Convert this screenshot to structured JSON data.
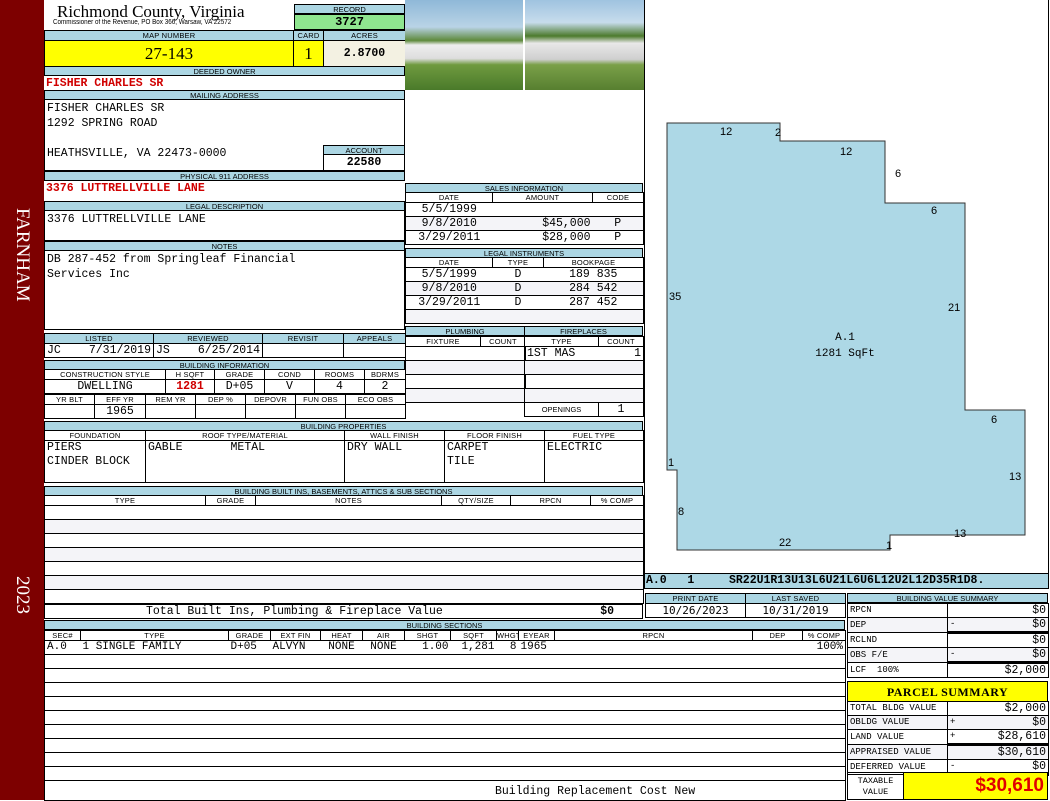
{
  "sidebar": {
    "district": "FARNHAM",
    "year": "2023"
  },
  "header": {
    "county": "Richmond County, Virginia",
    "office": "Commissioner of the Revenue, PO Box 366, Warsaw, VA 22572",
    "record_label": "RECORD",
    "record": "3727"
  },
  "parcel": {
    "map_label": "MAP NUMBER",
    "map_number": "27-143",
    "card_label": "CARD",
    "card": "1",
    "acres_label": "ACRES",
    "acres": "2.8700"
  },
  "owner": {
    "label": "DEEDED OWNER",
    "name": "FISHER CHARLES SR"
  },
  "mailing": {
    "label": "MAILING ADDRESS",
    "line1": "FISHER CHARLES SR",
    "line2": "1292 SPRING ROAD",
    "line3": "HEATHSVILLE, VA 22473-0000",
    "account_label": "ACCOUNT",
    "account": "22580"
  },
  "physical": {
    "label": "PHYSICAL 911 ADDRESS",
    "address": "3376 LUTTRELLVILLE LANE"
  },
  "legal": {
    "label": "LEGAL DESCRIPTION",
    "text": "3376 LUTTRELLVILLE LANE"
  },
  "notes": {
    "label": "NOTES",
    "line1": "DB 287-452 from Springleaf Financial",
    "line2": "Services Inc"
  },
  "review": {
    "listed_label": "LISTED",
    "reviewed_label": "REVIEWED",
    "revisit_label": "REVISIT",
    "appeals_label": "APPEALS",
    "listed_by": "JC",
    "listed_date": "7/31/2019",
    "reviewed_by": "JS",
    "reviewed_date": "6/25/2014"
  },
  "building_info": {
    "label": "BUILDING INFORMATION",
    "h1": [
      "CONSTRUCTION STYLE",
      "H SQFT",
      "GRADE",
      "COND",
      "ROOMS",
      "BDRMS"
    ],
    "v1": [
      "DWELLING",
      "1281",
      "D+05",
      "V",
      "4",
      "2"
    ],
    "h2": [
      "YR BLT",
      "EFF YR",
      "REM YR",
      "DEP %",
      "DEPOVR",
      "FUN OBS",
      "ECO OBS"
    ],
    "v2": [
      "",
      "1965",
      "",
      "",
      "",
      "",
      ""
    ]
  },
  "sales": {
    "label": "SALES INFORMATION",
    "headers": [
      "DATE",
      "AMOUNT",
      "CODE"
    ],
    "rows": [
      [
        "5/5/1999",
        "",
        ""
      ],
      [
        "9/8/2010",
        "$45,000",
        "P"
      ],
      [
        "3/29/2011",
        "$28,000",
        "P"
      ]
    ]
  },
  "instruments": {
    "label": "LEGAL INSTRUMENTS",
    "headers": [
      "DATE",
      "TYPE",
      "BOOKPAGE"
    ],
    "rows": [
      [
        "5/5/1999",
        "D",
        "189 835"
      ],
      [
        "9/8/2010",
        "D",
        "284 542"
      ],
      [
        "3/29/2011",
        "D",
        "287 452"
      ]
    ]
  },
  "plumbing": {
    "label": "PLUMBING",
    "headers": [
      "FIXTURE",
      "COUNT"
    ]
  },
  "fireplaces": {
    "label": "FIREPLACES",
    "headers": [
      "TYPE",
      "COUNT"
    ],
    "type": "1ST MAS",
    "count": "1",
    "openings_label": "OPENINGS",
    "openings": "1"
  },
  "properties": {
    "label": "BUILDING PROPERTIES",
    "headers": [
      "FOUNDATION",
      "ROOF TYPE/MATERIAL",
      "WALL FINISH",
      "FLOOR FINISH",
      "FUEL TYPE"
    ],
    "foundation1": "PIERS",
    "foundation2": "CINDER BLOCK",
    "roof_type": "GABLE",
    "roof_material": "METAL",
    "wall": "DRY WALL",
    "floor1": "CARPET",
    "floor2": "TILE",
    "fuel": "ELECTRIC"
  },
  "builtins": {
    "label": "BUILDING BUILT INS, BASEMENTS, ATTICS & SUB SECTIONS",
    "headers": [
      "TYPE",
      "GRADE",
      "NOTES",
      "QTY/SIZE",
      "RPCN",
      "% COMP"
    ],
    "total_label": "Total Built Ins, Plumbing & Fireplace Value",
    "total": "$0"
  },
  "sections": {
    "label": "BUILDING SECTIONS",
    "headers": [
      "SEC#",
      "TYPE",
      "GRADE",
      "EXT FIN",
      "HEAT",
      "AIR",
      "SHGT",
      "SQFT",
      "WHGT",
      "EYEAR",
      "RPCN",
      "DEP",
      "% COMP"
    ],
    "rows": [
      [
        "A.0",
        "1 SINGLE FAMILY",
        "D+05",
        "ALVYN",
        "NONE",
        "NONE",
        "1.00",
        "1,281",
        "8",
        "1965",
        "",
        "",
        "100%"
      ]
    ],
    "footer": "Building Replacement Cost New"
  },
  "sketch": {
    "area_label": "A.1",
    "area_sqft": "1281 SqFt",
    "code": "A.0   1",
    "vector": "SR22U1R13U13L6U21L6U6L12U2L12D35R1D8.",
    "dims": [
      "12",
      "2",
      "12",
      "6",
      "6",
      "21",
      "35",
      "6",
      "1",
      "13",
      "8",
      "13",
      "22",
      "1"
    ],
    "fill": "#add8e6"
  },
  "dates": {
    "print_label": "PRINT DATE",
    "print_date": "10/26/2023",
    "saved_label": "LAST SAVED",
    "last_saved": "10/31/2019"
  },
  "value_summary": {
    "label": "BUILDING VALUE SUMMARY",
    "rows": [
      [
        "RPCN",
        "",
        "$0"
      ],
      [
        "DEP",
        "-",
        "$0"
      ],
      [
        "RCLND",
        "",
        "$0"
      ],
      [
        "OBS F/E",
        "-",
        "$0"
      ],
      [
        "LCF  100%",
        "",
        "$2,000"
      ]
    ]
  },
  "parcel_summary": {
    "label": "PARCEL SUMMARY",
    "rows": [
      [
        "TOTAL BLDG VALUE",
        "",
        "$2,000"
      ],
      [
        "OBLDG VALUE",
        "+",
        "$0"
      ],
      [
        "LAND VALUE",
        "+",
        "$28,610"
      ],
      [
        "APPRAISED VALUE",
        "",
        "$30,610"
      ],
      [
        "DEFERRED VALUE",
        "-",
        "$0"
      ]
    ],
    "taxable_label1": "TAXABLE",
    "taxable_label2": "VALUE",
    "taxable": "$30,610"
  }
}
